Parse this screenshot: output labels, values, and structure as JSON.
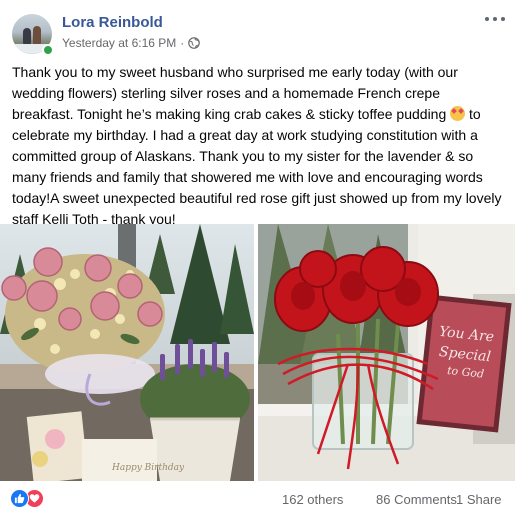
{
  "post": {
    "author": "Lora Reinbold",
    "timestamp": "Yesterday at 6:16 PM",
    "separator": "·",
    "privacy_icon": "globe-icon",
    "text_part1": "Thank you to my sweet husband who surprised me early today (with our wedding flowers) sterling silver roses and a homemade French crepe breakfast. Tonight he’s making king crab cakes & sticky toffee pudding ",
    "emoji": "smiling-face-with-hearts",
    "text_part2": " to celebrate my birthday. I had a great day at work studying constitution with a committed group of Alaskans. Thank you to my sister for the lavender & so many friends and family that showered me with love and encouraging words today!A sweet unexpected beautiful red rose gift just showed up from my lovely staff Kelli Toth - thank you!",
    "photos": [
      {
        "name": "photo-pink-roses-lavender",
        "card_text": "Happy Birthday"
      },
      {
        "name": "photo-red-roses-vase",
        "card_text": "You Are Special to God"
      }
    ],
    "reactions": {
      "icons": [
        "like-icon",
        "love-icon"
      ],
      "others": "162 others",
      "comments": "86 Comments",
      "shares": "1 Share"
    }
  },
  "colors": {
    "name": "#385898",
    "meta": "#65676b",
    "like": "#1877f2",
    "love": "#f33e58",
    "online": "#31a24c"
  }
}
